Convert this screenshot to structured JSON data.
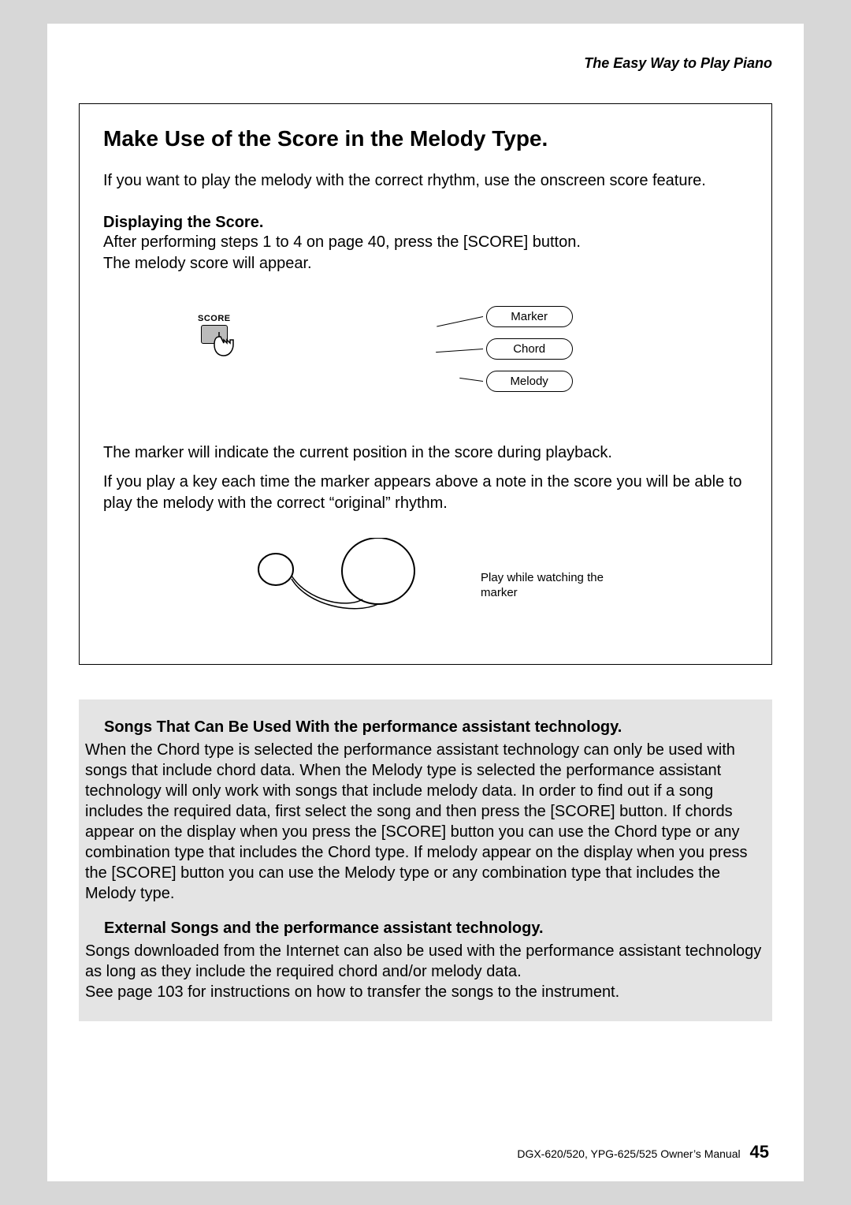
{
  "running_head": "The Easy Way to Play Piano",
  "box": {
    "title": "Make Use of the Score in the Melody Type.",
    "intro": "If you want to play the melody with the correct rhythm, use the onscreen score feature.",
    "subhead": "Displaying the Score.",
    "instr1": "After performing steps 1 to 4 on page 40, press the [SCORE] button.",
    "instr2": "The melody score will appear.",
    "score_button_label": "SCORE",
    "callouts": {
      "marker": "Marker",
      "chord": "Chord",
      "melody": "Melody"
    },
    "marker_desc1": "The marker will indicate the current position in the score during playback.",
    "marker_desc2": "If you play a key each time the marker appears above a note in the score you will be able to play the melody with the correct “original” rhythm.",
    "play_caption": "Play while watching the marker"
  },
  "gray": {
    "h1": "Songs That Can Be Used With the performance assistant technology.",
    "p1": "When the Chord type is selected the performance assistant technology can only be used with songs that include chord data. When the Melody type is selected the performance assistant technology will only work with songs that include melody data. In order to ﬁnd out if a song includes the required data, ﬁrst select the song and then press the [SCORE] button. If chords appear on the display when you press the [SCORE] button you can use the Chord type or any combination type that includes the Chord type. If melody appear on the display when you press the [SCORE] button you can use the Melody type or any combination type that includes the Melody type.",
    "h2": "External Songs and the performance assistant technology.",
    "p2a": "Songs downloaded from the Internet can also be used with the performance assistant technology as long as they include the required chord and/or melody data.",
    "p2b": "See page 103 for instructions on how to transfer the songs to the instrument."
  },
  "footer": {
    "manual": "DGX-620/520, YPG-625/525  Owner’s Manual",
    "page": "45"
  }
}
